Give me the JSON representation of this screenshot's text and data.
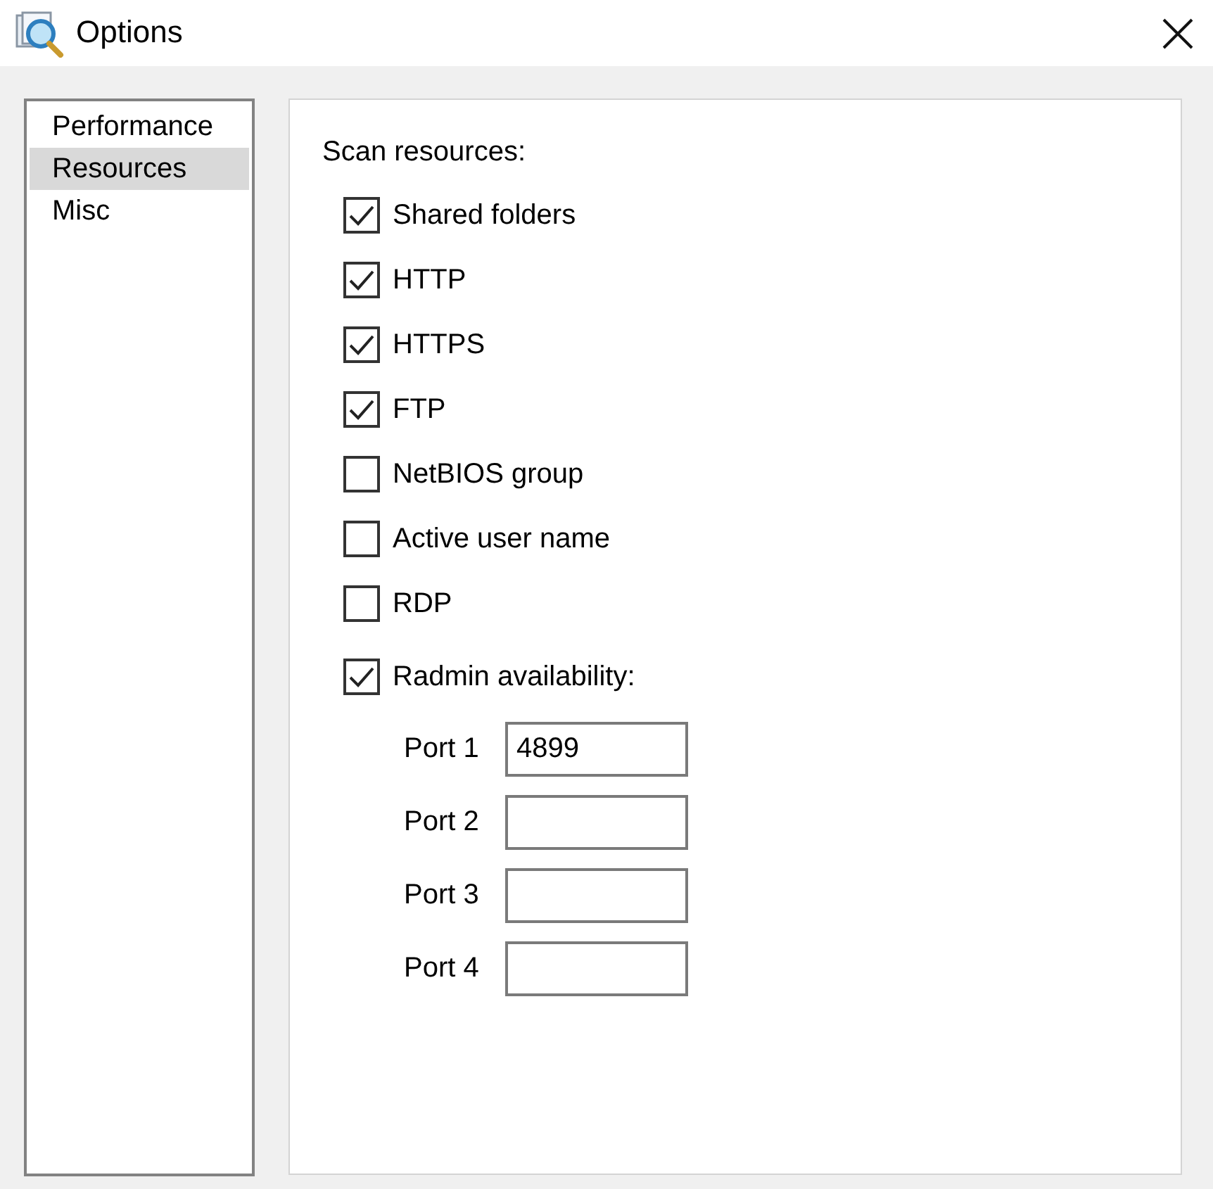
{
  "window": {
    "title": "Options"
  },
  "sidebar": {
    "items": [
      {
        "label": "Performance",
        "selected": false
      },
      {
        "label": "Resources",
        "selected": true
      },
      {
        "label": "Misc",
        "selected": false
      }
    ]
  },
  "panel": {
    "heading": "Scan resources:",
    "options": [
      {
        "label": "Shared folders",
        "checked": true
      },
      {
        "label": "HTTP",
        "checked": true
      },
      {
        "label": "HTTPS",
        "checked": true
      },
      {
        "label": "FTP",
        "checked": true
      },
      {
        "label": "NetBIOS group",
        "checked": false
      },
      {
        "label": "Active user name",
        "checked": false
      },
      {
        "label": "RDP",
        "checked": false
      },
      {
        "label": "Radmin availability:",
        "checked": true
      }
    ],
    "ports": [
      {
        "label": "Port 1",
        "value": "4899"
      },
      {
        "label": "Port 2"
      },
      {
        "label": "Port 3"
      },
      {
        "label": "Port 4"
      }
    ]
  }
}
